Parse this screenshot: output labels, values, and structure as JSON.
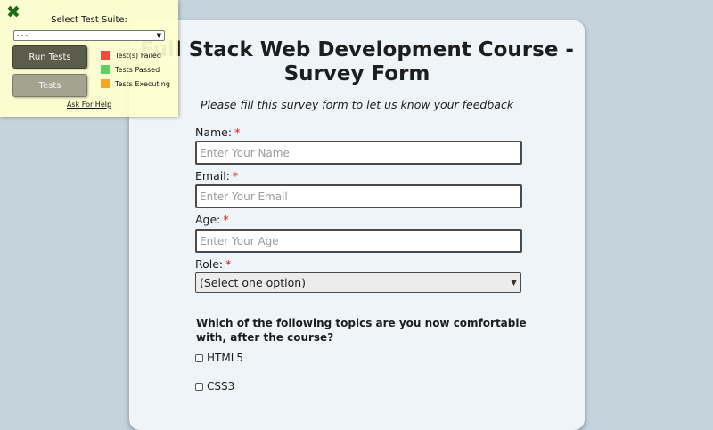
{
  "survey": {
    "title": "Full Stack Web Development Course - Survey Form",
    "description": "Please fill this survey form to let us know your feedback",
    "fields": {
      "name": {
        "label": "Name:",
        "required_mark": "*",
        "placeholder": "Enter Your Name"
      },
      "email": {
        "label": "Email:",
        "required_mark": "*",
        "placeholder": "Enter Your Email"
      },
      "age": {
        "label": "Age:",
        "required_mark": "*",
        "placeholder": "Enter Your Age"
      },
      "role": {
        "label": "Role:",
        "required_mark": "*",
        "selected": "(Select one option)"
      }
    },
    "topics_question": "Which of the following topics are you now comfortable with, after the course?",
    "topics": [
      {
        "label": "HTML5",
        "checked": false
      },
      {
        "label": "CSS3",
        "checked": false
      }
    ]
  },
  "test_panel": {
    "close_icon": "close-icon",
    "suite_label": "Select Test Suite:",
    "suite_selected": "- - -",
    "run_button": "Run Tests",
    "tests_button": "Tests",
    "legend": [
      {
        "label": "Test(s) Failed",
        "color": "#ee4b3f"
      },
      {
        "label": "Tests Passed",
        "color": "#5fd15f"
      },
      {
        "label": "Tests Executing",
        "color": "#f5a623"
      }
    ],
    "help_link": "Ask For Help"
  },
  "colors": {
    "page_background": "#c5d3dd",
    "card_background": "#eff4f9",
    "required_mark": "#dd1111",
    "panel_background": "#ffffcd"
  }
}
